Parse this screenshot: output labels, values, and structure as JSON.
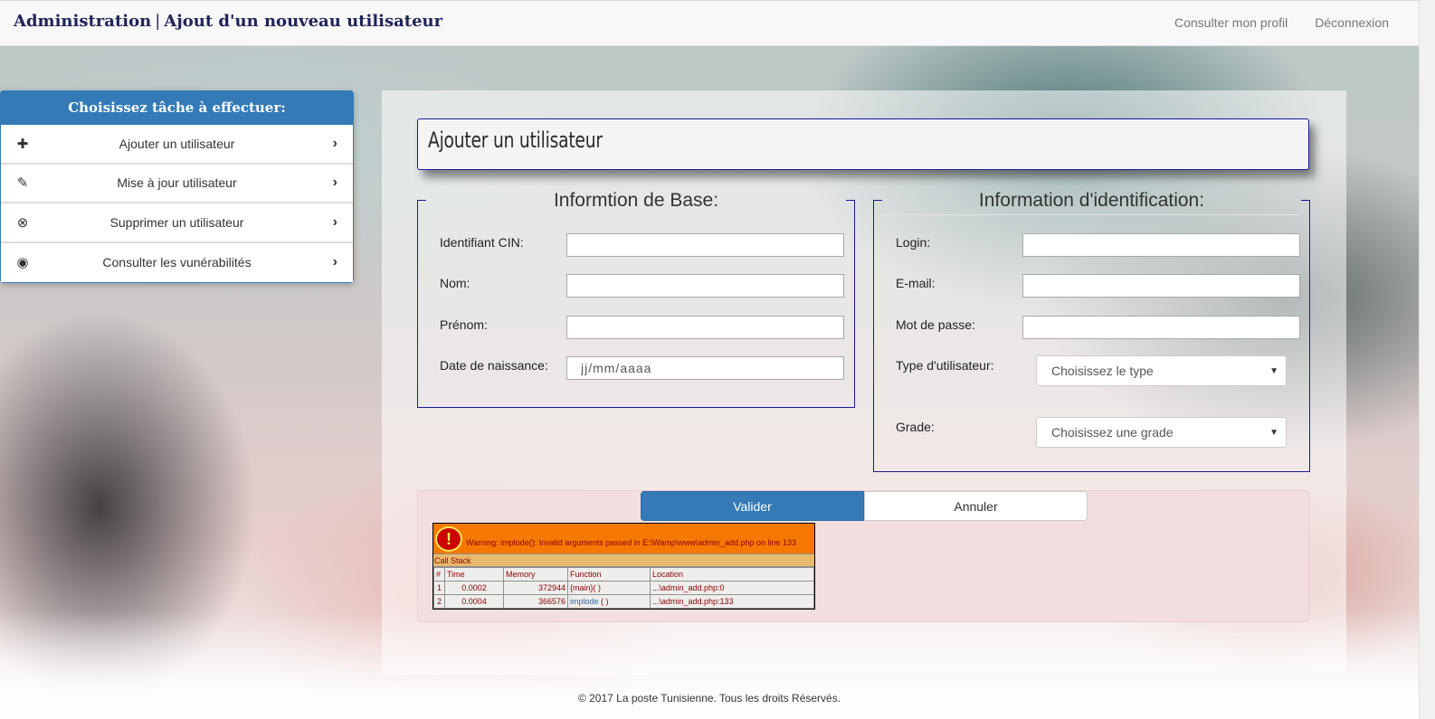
{
  "navbar": {
    "brand_main": "Administration",
    "brand_sep": "|",
    "brand_sub": "Ajout d'un nouveau utilisateur",
    "links": [
      "Consulter mon profil",
      "Déconnexion"
    ]
  },
  "sidebar": {
    "title": "Choisissez tâche à effectuer:",
    "items": [
      {
        "label": "Ajouter un utilisateur",
        "icon": "plus-icon"
      },
      {
        "label": "Mise à jour utilisateur",
        "icon": "pencil-icon"
      },
      {
        "label": "Supprimer un utilisateur",
        "icon": "remove-circle-icon"
      },
      {
        "label": "Consulter les vunérabilités",
        "icon": "eye-icon"
      }
    ]
  },
  "main": {
    "title": "Ajouter un utilisateur",
    "base_info": {
      "legend": "Informtion de Base:",
      "fields": [
        {
          "label": "Identifiant CIN:",
          "value": "",
          "placeholder": ""
        },
        {
          "label": "Nom:",
          "value": "",
          "placeholder": ""
        },
        {
          "label": "Prénom:",
          "value": "",
          "placeholder": ""
        },
        {
          "label": "Date de naissance:",
          "value": "",
          "placeholder": "jj/mm/aaaa"
        }
      ]
    },
    "ident_info": {
      "legend": "Information d'identification:",
      "fields": [
        {
          "label": "Login:",
          "value": ""
        },
        {
          "label": "E-mail:",
          "value": ""
        },
        {
          "label": "Mot de passe:",
          "value": ""
        }
      ],
      "selects": [
        {
          "label": "Type d'utilisateur:",
          "selected": "Choisissez le type"
        },
        {
          "label": "Grade:",
          "selected": "Choisissez une grade"
        }
      ]
    },
    "actions": {
      "submit": "Valider",
      "cancel": "Annuler"
    }
  },
  "xdebug": {
    "bang": "!",
    "warning": "Warning: implode(): Invalid arguments passed in E:\\Wamp\\www\\admin_add.php on line 133",
    "callstack_title": "Call Stack",
    "headers": [
      "#",
      "Time",
      "Memory",
      "Function",
      "Location"
    ],
    "rows": [
      {
        "n": "1",
        "time": "0.0002",
        "memory": "372944",
        "function": "{main}( )",
        "location": "...\\admin_add.php:0"
      },
      {
        "n": "2",
        "time": "0.0004",
        "memory": "366576",
        "function": "implode",
        "function_args": " ( )",
        "location": "...\\admin_add.php:133"
      }
    ]
  },
  "footer": "© 2017 La poste Tunisienne. Tous les droits Réservés.",
  "colors": {
    "primary": "#337ab7",
    "brand": "#1e2358",
    "fieldset_border": "#1a1a9a",
    "alert_bg": "#f2dede",
    "xdebug_orange": "#f57900"
  }
}
